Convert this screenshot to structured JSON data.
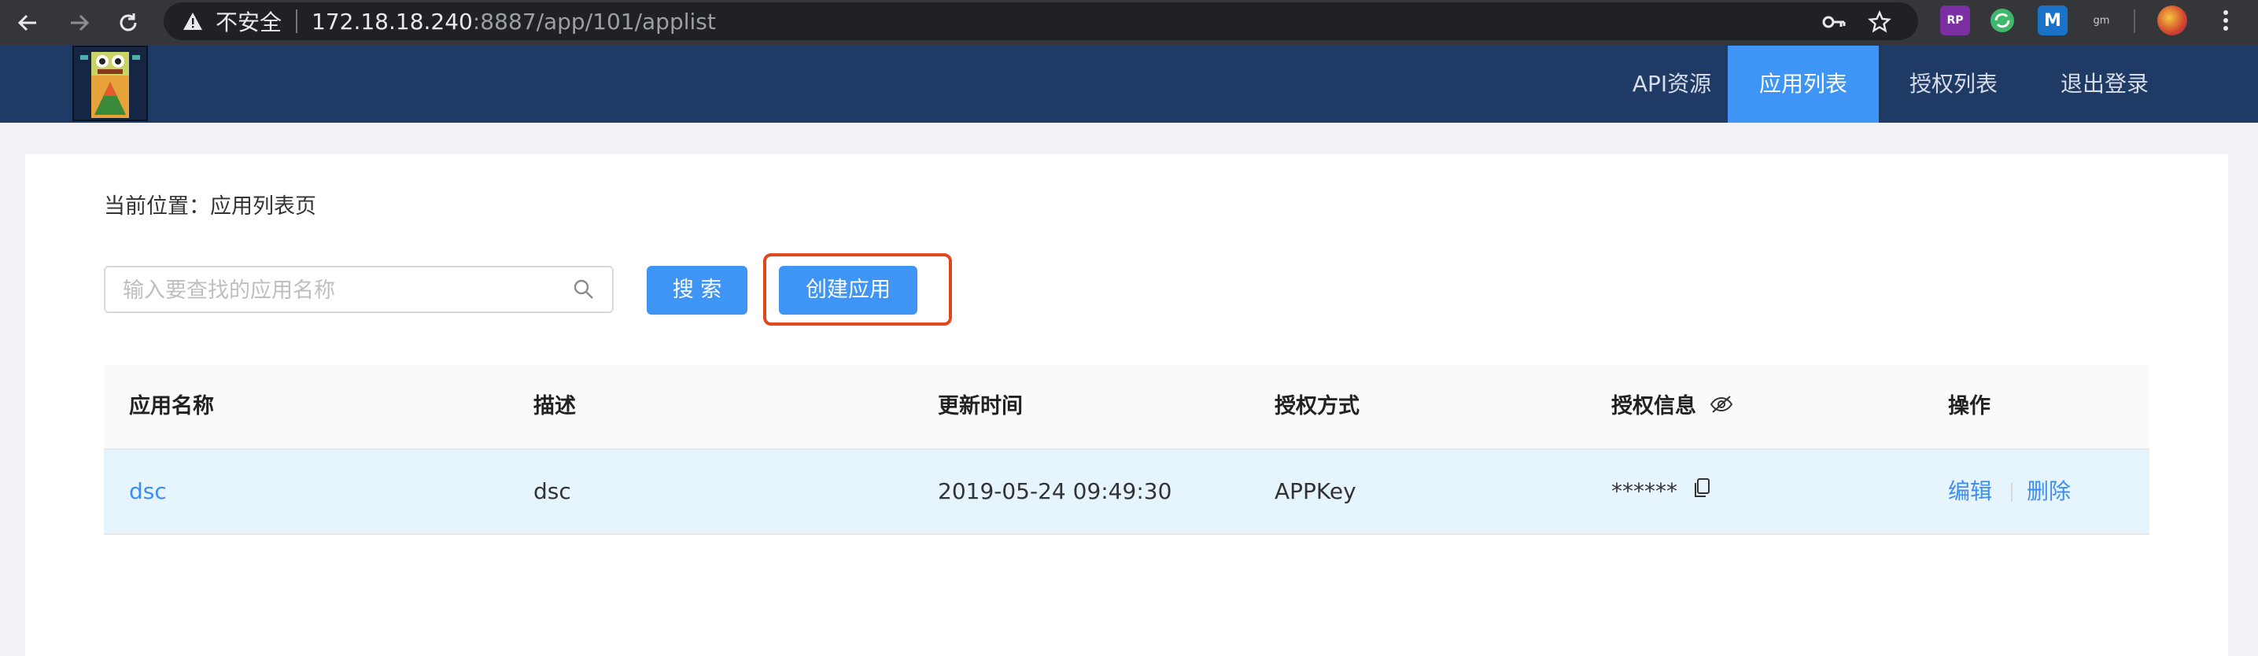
{
  "browser": {
    "insecure_label": "不安全",
    "url_host": "172.18.18.240",
    "url_path": ":8887/app/101/applist",
    "extensions": [
      "RP",
      "sync",
      "M",
      "gm"
    ]
  },
  "header": {
    "nav": [
      {
        "label": "API资源",
        "active": false
      },
      {
        "label": "应用列表",
        "active": true
      },
      {
        "label": "授权列表",
        "active": false
      },
      {
        "label": "退出登录",
        "active": false
      }
    ]
  },
  "breadcrumb": "当前位置：应用列表页",
  "search": {
    "placeholder": "输入要查找的应用名称",
    "value": "",
    "button_label": "搜 索"
  },
  "create_button_label": "创建应用",
  "table": {
    "columns": [
      "应用名称",
      "描述",
      "更新时间",
      "授权方式",
      "授权信息",
      "操作"
    ],
    "rows": [
      {
        "name": "dsc",
        "description": "dsc",
        "updated": "2019-05-24 09:49:30",
        "auth_type": "APPKey",
        "auth_info": "******",
        "edit_label": "编辑",
        "delete_label": "删除"
      }
    ]
  },
  "colors": {
    "header_bg": "#1f3a64",
    "accent": "#3e95f5",
    "highlight_border": "#e1461e",
    "row_highlight": "#e6f4fd"
  }
}
